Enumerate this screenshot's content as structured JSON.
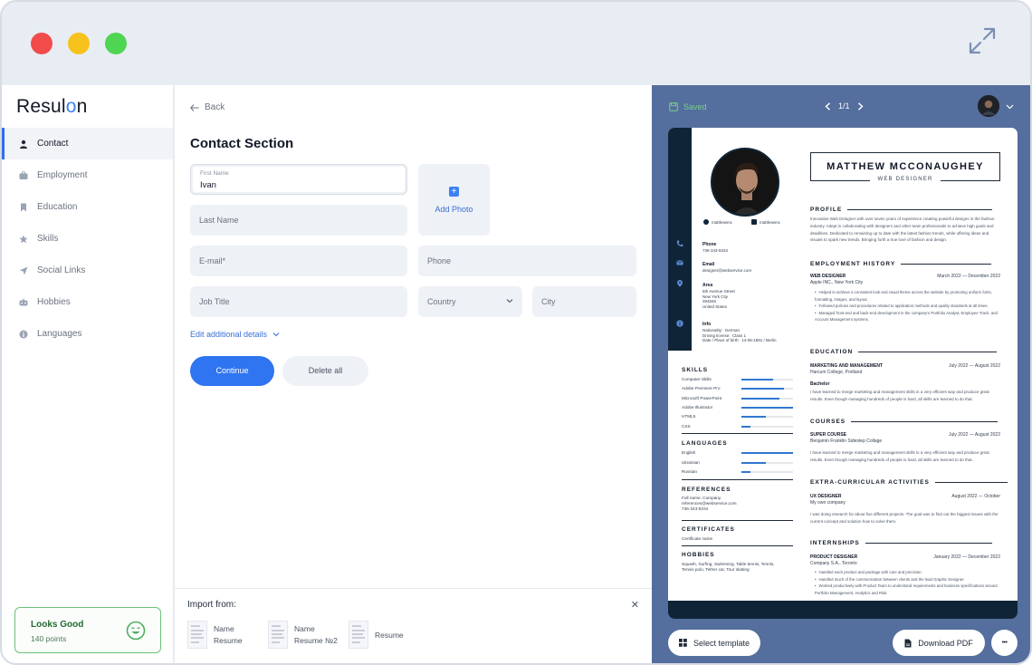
{
  "sidebar": {
    "logo": "Resulon",
    "items": [
      {
        "label": "Contact",
        "icon": "person-icon"
      },
      {
        "label": "Employment",
        "icon": "briefcase-icon"
      },
      {
        "label": "Education",
        "icon": "bookmark-icon"
      },
      {
        "label": "Skills",
        "icon": "star-icon"
      },
      {
        "label": "Social Links",
        "icon": "send-icon"
      },
      {
        "label": "Hobbies",
        "icon": "gamepad-icon"
      },
      {
        "label": "Languages",
        "icon": "info-icon"
      }
    ],
    "score": {
      "title": "Looks Good",
      "points": "140 points"
    }
  },
  "form": {
    "back_label": "Back",
    "title": "Contact Section",
    "first_name_label": "First Name",
    "first_name_value": "Ivan",
    "last_name_placeholder": "Last Name",
    "email_placeholder": "E-mail*",
    "phone_placeholder": "Phone",
    "job_title_placeholder": "Job Title",
    "country_placeholder": "Country",
    "city_placeholder": "City",
    "add_photo_label": "Add Photo",
    "additional_details_label": "Edit additional details",
    "continue_label": "Continue",
    "delete_label": "Delete all"
  },
  "import": {
    "title": "Import from:",
    "items": [
      {
        "line1": "Name",
        "line2": "Resume"
      },
      {
        "line1": "Name",
        "line2": "Resume №2"
      },
      {
        "line1": "Resume",
        "line2": ""
      }
    ]
  },
  "preview": {
    "saved_label": "Saved",
    "page_indicator": "1/1",
    "select_template_label": "Select template",
    "download_label": "Download PDF",
    "more_label": "•••"
  },
  "resume": {
    "name": "MATTHEW MCCONAUGHEY",
    "role": "WEB DESIGNER",
    "social": [
      "matthewmc",
      "matthewmc"
    ],
    "contact": {
      "phone_label": "Phone",
      "phone": "736-343-9334",
      "email_label": "Email",
      "email": "designer@webservice.com",
      "area_label": "Area",
      "area": "5th Avenue Street\nNew York City\n384846\nUnited States",
      "info_label": "Info",
      "info": "Nationality:  German\nDriving license:  Class 1\nDate / Place of birth:  14-08-1991 / Berlin"
    },
    "skills_title": "SKILLS",
    "skills": [
      {
        "name": "Computer Skills",
        "level": 0.62
      },
      {
        "name": "Adobe Premiere Pro",
        "level": 0.82
      },
      {
        "name": "Microsoft PowerPoint",
        "level": 0.74
      },
      {
        "name": "Adobe Illustrator",
        "level": 1.0
      },
      {
        "name": "HTML5",
        "level": 0.48
      },
      {
        "name": "CSS",
        "level": 0.18
      }
    ],
    "languages_title": "LANGUAGES",
    "languages": [
      {
        "name": "English",
        "level": 1.0
      },
      {
        "name": "Ukrainian",
        "level": 0.48
      },
      {
        "name": "Russian",
        "level": 0.18
      }
    ],
    "references_title": "REFERENCES",
    "references": "Full name, Company\nreferences@webservice.com\n736-343-9334",
    "certificates_title": "CERTIFICATES",
    "certificates": "Certificate name",
    "hobbies_title": "HOBBIES",
    "hobbies": "Squash, Surfing, Swimming, Table tennis, Tennis,\nTennis polo, Tether car, Tour skating",
    "profile_title": "PROFILE",
    "profile": "Innovative Web Designer with over seven years of experience creating powerful designs in the fashion industry. Adept in collaborating with designers and other team professionals to achieve high goals and deadlines. Dedicated to remaining up to date with the latest fashion trends, while offering ideas and visuals to spark new trends. Bringing forth a true love of fashion and design.",
    "employment_title": "EMPLOYMENT HISTORY",
    "employment": {
      "title": "WEB DESIGNER",
      "date": "March 2022 — December 2022",
      "company": "Apple INC., New York City",
      "bullets": [
        "Helped to achieve a consistent look and visual theme across the website by promoting uniform fonts, formatting, images, and layout.",
        "Followed policies and procedures related to application methods and quality standards at all times.",
        "Managed front-end and back-end development in the company's Portfolio Analyst, Employee Track, and Account Management systems."
      ]
    },
    "education_title": "EDUCATION",
    "education": {
      "title": "MARKETING AND MANAGEMENT",
      "date": "July 2022 — August 2022",
      "school": "Harcum College, Portland",
      "degree": "Bachelor",
      "text": "I have learned to merge marketing and management skills in a very efficient way and produce great results. Even though managing hundreds of people is hard, all skills are learned to do that."
    },
    "courses_title": "COURSES",
    "courses": {
      "title": "SUPER COURSE",
      "date": "July 2022 — August 2022",
      "school": "Benjamin Franklin Sidestep Collage",
      "text": "I have learned to merge marketing and management skills in a very efficient way and produce great results. Even though managing hundreds of people is hard, all skills are learned to do that."
    },
    "extra_title": "EXTRA-CURRICULAR ACTIVITIES",
    "extra": {
      "title": "UX DESIGNER",
      "date": "August 2022 — October",
      "company": "My own company",
      "text": "I was doing research for about five different projects. The goal was to find out the biggest issues with the current concept and solution how to solve them."
    },
    "internships_title": "INTERNSHIPS",
    "internships": {
      "title": "PRODUCT DESIGNER",
      "date": "January 2022 — December 2022",
      "company": "Company S.A., Toronto",
      "bullets": [
        "Handled each product and package with care and precision.",
        "Handled much of the communication between clients and the lead Graphic Designer.",
        "Worked productively with Product Team to understand requirements and business specifications around Portfolio Management, Analytics and Risk."
      ]
    }
  },
  "colors": {
    "accent": "#2f74f0",
    "preview_bg": "#546e9d",
    "resume_navy": "#0f2537",
    "saved_green": "#79d18c"
  }
}
